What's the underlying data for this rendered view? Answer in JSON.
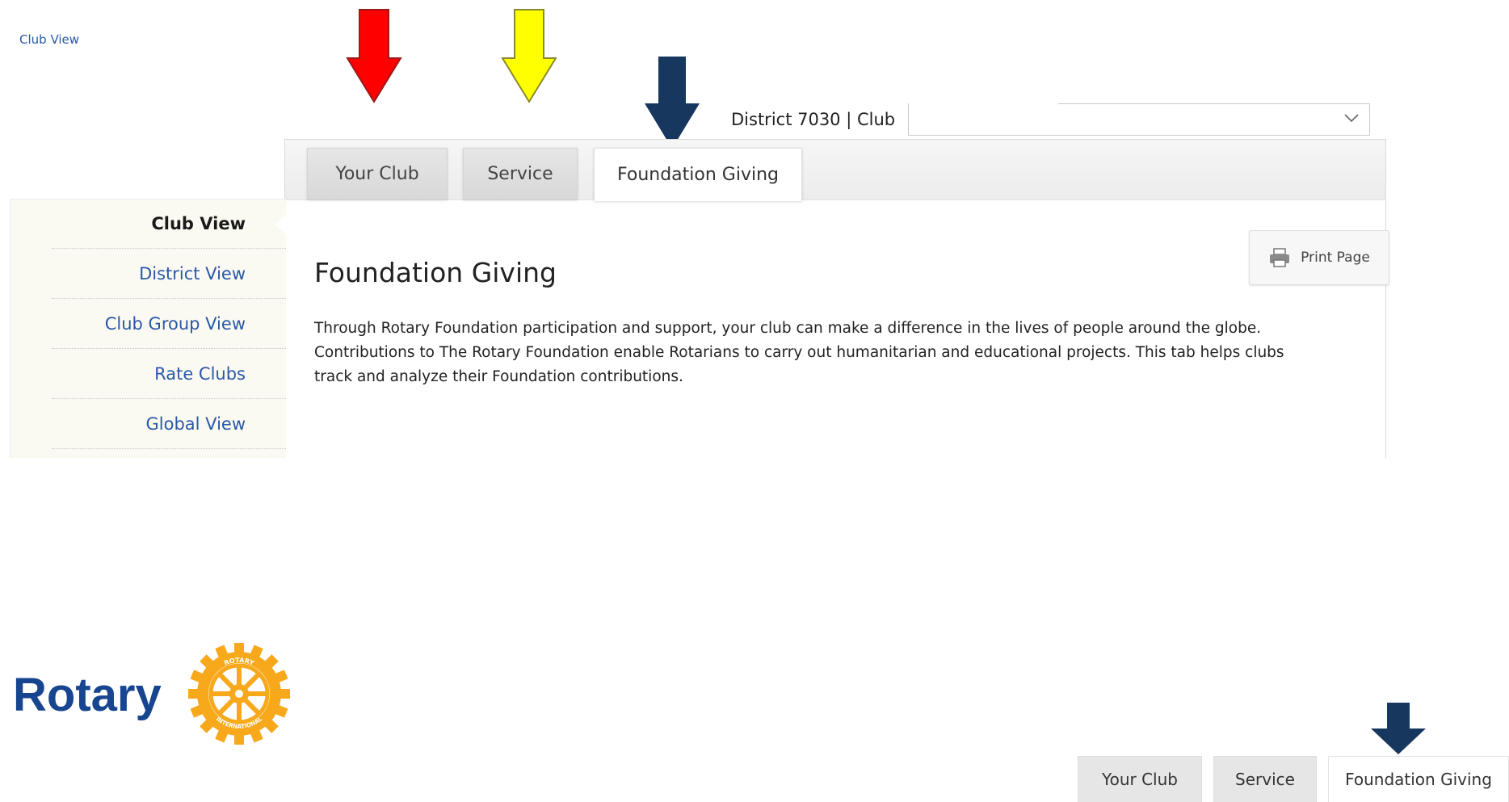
{
  "breadcrumb": {
    "label": "Club View"
  },
  "selector": {
    "district_text": "District 7030 | Club",
    "club_value": ""
  },
  "tabs": [
    {
      "label": "Your Club",
      "active": false
    },
    {
      "label": "Service",
      "active": false
    },
    {
      "label": "Foundation Giving",
      "active": true
    }
  ],
  "sidebar": {
    "items": [
      {
        "label": "Club View",
        "active": true
      },
      {
        "label": "District View",
        "active": false
      },
      {
        "label": "Club Group View",
        "active": false
      },
      {
        "label": "Rate Clubs",
        "active": false
      },
      {
        "label": "Global View",
        "active": false
      }
    ]
  },
  "content": {
    "title": "Foundation Giving",
    "paragraph_line1": "Through Rotary Foundation participation and support, your club can make a difference in the lives of people around the globe.",
    "paragraph_line2": "Contributions to The Rotary Foundation enable Rotarians to carry out humanitarian and educational projects. This tab helps clubs",
    "paragraph_line3": "track and analyze their Foundation contributions."
  },
  "print_button": {
    "label": "Print Page",
    "icon": "printer-icon"
  },
  "logo": {
    "word": "Rotary",
    "wheel_text_top": "ROTARY",
    "wheel_text_bottom": "INTERNATIONAL"
  },
  "arrows": [
    {
      "color": "#ff0000",
      "target": "Your Club"
    },
    {
      "color": "#ffff00",
      "target": "Service"
    },
    {
      "color": "#17375e",
      "target": "Foundation Giving"
    }
  ],
  "mini_tabs": [
    {
      "label": "Your Club",
      "active": false
    },
    {
      "label": "Service",
      "active": false
    },
    {
      "label": "Foundation Giving",
      "active": true
    }
  ],
  "colors": {
    "link": "#2a58a8",
    "rotary_blue": "#17458f",
    "rotary_gold": "#f7a81b"
  }
}
